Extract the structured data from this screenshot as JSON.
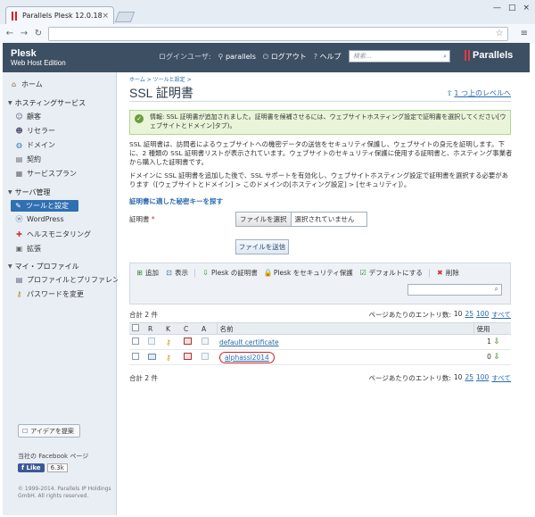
{
  "browser": {
    "tab_title": "Parallels Plesk 12.0.18",
    "tab_close": "×",
    "win_min": "—",
    "win_max": "□",
    "win_close": "×"
  },
  "header": {
    "brand_line1": "Plesk",
    "brand_line2": "Web Host Edition",
    "login_label": "ログインユーザ:",
    "username": "parallels",
    "logout": "ログアウト",
    "help": "ヘルプ",
    "search_placeholder": "検索...",
    "logo_text": "Parallels"
  },
  "sidebar": {
    "home": "ホーム",
    "hosting_head": "ホスティングサービス",
    "hosting_items": [
      "顧客",
      "リセラー",
      "ドメイン",
      "契約",
      "サービスプラン"
    ],
    "server_head": "サーバ管理",
    "server_items": [
      "ツールと設定",
      "WordPress",
      "ヘルスモニタリング",
      "拡張"
    ],
    "profile_head": "マイ・プロファイル",
    "profile_items": [
      "プロファイルとプリファレンス",
      "パスワードを変更"
    ],
    "idea_button": "アイデアを提案",
    "facebook_label": "当社の Facebook ページ",
    "like_label": "Like",
    "like_count": "6.3k",
    "copyright": "© 1999-2014. Parallels IP Holdings GmbH. All rights reserved."
  },
  "main": {
    "breadcrumb": "ホーム > ツールと設定 >",
    "title": "SSL 証明書",
    "up_link": "1 つ上のレベルへ",
    "message": "情報: SSL 証明書が追加されました。証明書を候補させるには、ウェブサイトホスティング設定で証明書を選択してください[ウェブサイトとドメイン]タブ)。",
    "para1": "SSL 証明書は、訪問者によるウェブサイトへの機密データの送信をセキュリティ保護し、ウェブサイトの身元を証明します。下に、2 種類の SSL 証明書リストが表示されています。ウェブサイトのセキュリティ保護に使用する証明書と、ホスティング事業者から購入した証明書です。",
    "para2": "ドメインに SSL 証明書を追加した後で、SSL サポートを有効化し、ウェブサイトホスティング設定で証明書を選択する必要があります（[ウェブサイトとドメイン] > このドメインの[ホスティング設定] > [セキュリティ]）。",
    "section_label": "証明書に適した秘密キーを探す",
    "cert_label": "証明書",
    "required_mark": "*",
    "file_button": "ファイルを選択",
    "file_status": "選択されていません",
    "submit_button": "ファイルを送信",
    "toolbar": {
      "add": "追加",
      "view": "表示",
      "plesk_cert": "Plesk の証明書",
      "secure_plesk": "Plesk をセキュリティ保護",
      "set_default": "デフォルトにする",
      "delete": "削除"
    },
    "total": "合計 2 件",
    "per_page_label": "ページあたりのエントリ数:",
    "per_page_options": [
      "10",
      "25",
      "100",
      "すべて"
    ],
    "table": {
      "headers": [
        "R",
        "K",
        "C",
        "A",
        "名前",
        "使用"
      ],
      "rows": [
        {
          "name": "default certificate",
          "usage": "1"
        },
        {
          "name": "alphassl2014",
          "usage": "0"
        }
      ]
    }
  }
}
